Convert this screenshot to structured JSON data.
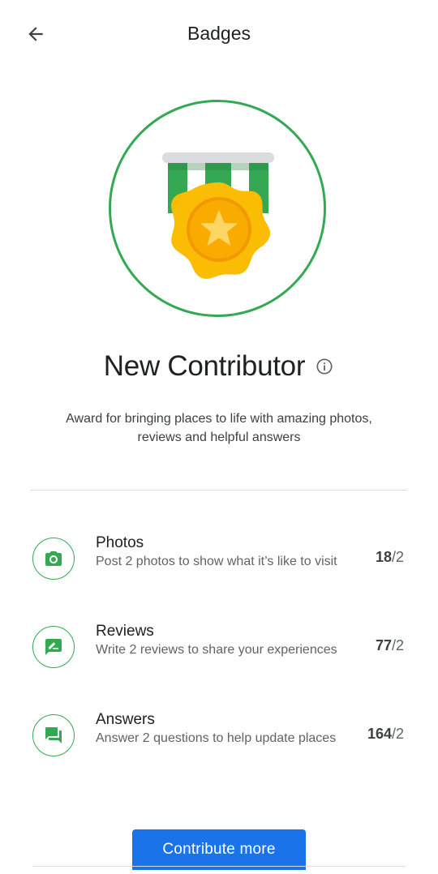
{
  "header": {
    "title": "Badges",
    "back_icon": "arrow-back-icon"
  },
  "badge": {
    "name": "New Contributor",
    "info_icon": "info-icon",
    "medal_icon": "medal-icon",
    "description": "Award for bringing places to life with amazing photos, reviews and helpful answers"
  },
  "requirements": [
    {
      "icon": "camera-icon",
      "title": "Photos",
      "description": "Post 2 photos to show what it’s like to visit",
      "current": "18",
      "target": "/2"
    },
    {
      "icon": "review-icon",
      "title": "Reviews",
      "description": "Write 2 reviews to share your experiences",
      "current": "77",
      "target": "/2"
    },
    {
      "icon": "answer-icon",
      "title": "Answers",
      "description": "Answer 2 questions to help update places",
      "current": "164",
      "target": "/2"
    }
  ],
  "actions": {
    "contribute_label": "Contribute more"
  },
  "colors": {
    "accent_green": "#34a853",
    "primary_blue": "#1a73e8",
    "medal_gold": "#fbbc04"
  }
}
